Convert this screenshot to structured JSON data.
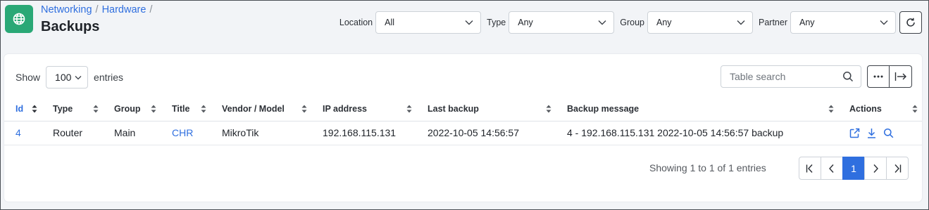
{
  "header": {
    "breadcrumb": [
      "Networking",
      "Hardware"
    ],
    "breadcrumb_sep": "/",
    "title": "Backups",
    "icon": "globe-network-icon",
    "filters": [
      {
        "label": "Location",
        "value": "All"
      },
      {
        "label": "Type",
        "value": "Any"
      },
      {
        "label": "Group",
        "value": "Any"
      },
      {
        "label": "Partner",
        "value": "Any"
      }
    ],
    "refresh_icon": "refresh-icon"
  },
  "table_controls": {
    "show_label": "Show",
    "page_length": "100",
    "entries_label": "entries",
    "search_placeholder": "Table search"
  },
  "columns": [
    "Id",
    "Type",
    "Group",
    "Title",
    "Vendor / Model",
    "IP address",
    "Last backup",
    "Backup message",
    "Actions"
  ],
  "rows": [
    {
      "id": "4",
      "type": "Router",
      "group": "Main",
      "title": "CHR",
      "vendor_model": "MikroTik",
      "ip_address": "192.168.115.131",
      "last_backup": "2022-10-05 14:56:57",
      "backup_message": "4 - 192.168.115.131 2022-10-05 14:56:57 backup",
      "actions": [
        "open-external-icon",
        "download-icon",
        "search-icon"
      ]
    }
  ],
  "footer": {
    "info": "Showing 1 to 1 of 1 entries",
    "current_page": "1"
  },
  "colors": {
    "accent": "#2f6fdf",
    "app_icon": "#2aa876"
  }
}
